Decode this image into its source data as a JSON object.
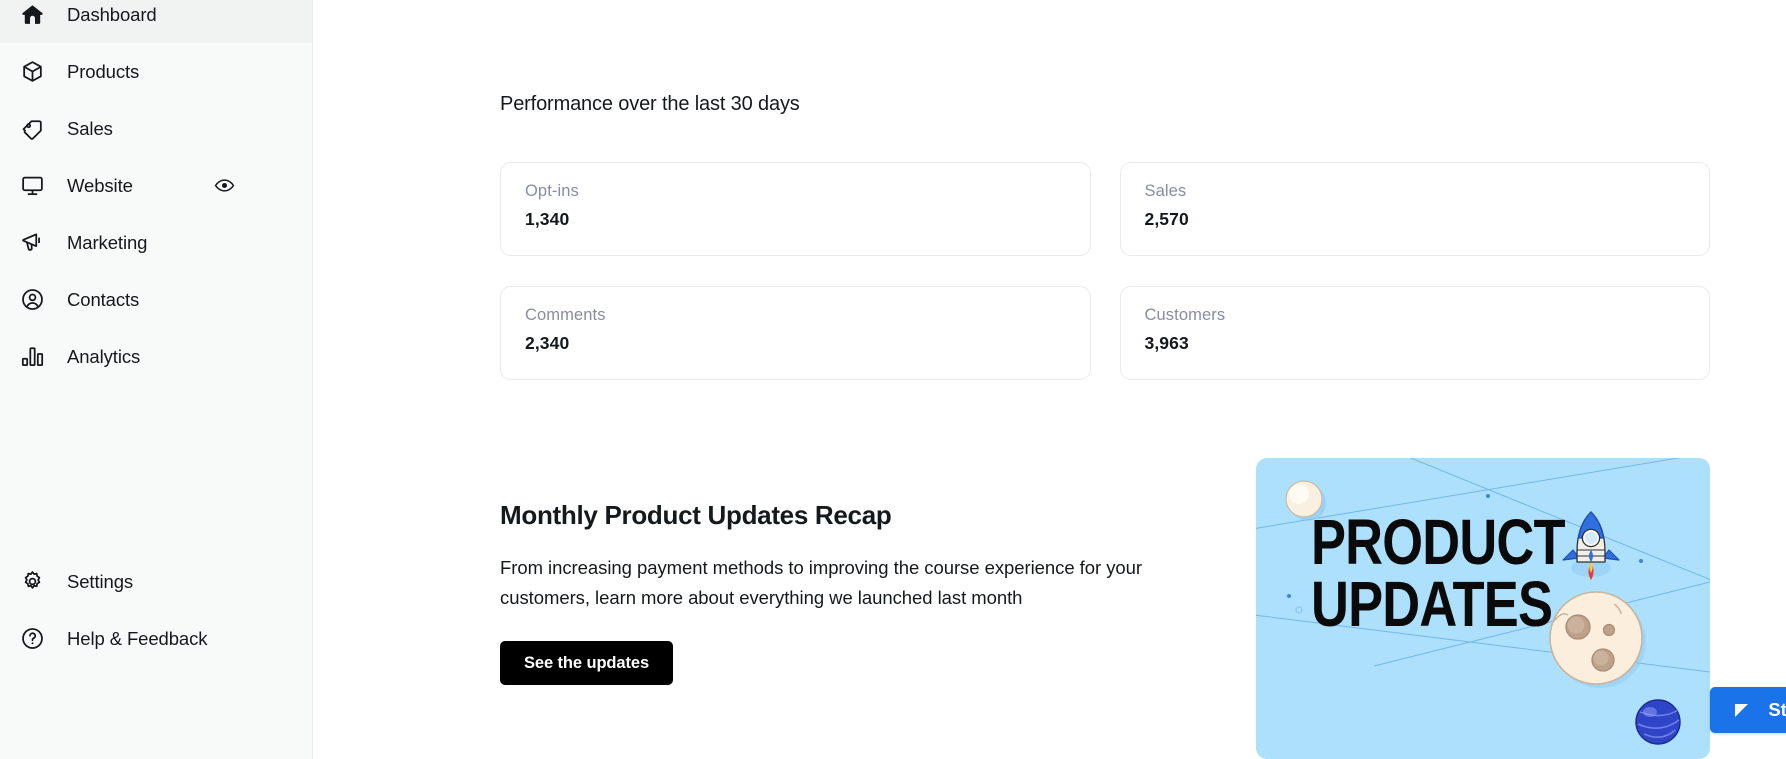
{
  "sidebar": {
    "top_items": [
      {
        "label": "Dashboard",
        "icon": "home-icon"
      },
      {
        "label": "Products",
        "icon": "box-icon"
      },
      {
        "label": "Sales",
        "icon": "tag-icon"
      },
      {
        "label": "Website",
        "icon": "monitor-icon",
        "trailing_icon": "eye-icon"
      },
      {
        "label": "Marketing",
        "icon": "megaphone-icon"
      },
      {
        "label": "Contacts",
        "icon": "user-circle-icon"
      },
      {
        "label": "Analytics",
        "icon": "bar-chart-icon"
      }
    ],
    "bottom_items": [
      {
        "label": "Settings",
        "icon": "gear-icon"
      },
      {
        "label": "Help & Feedback",
        "icon": "question-circle-icon"
      }
    ]
  },
  "main": {
    "performance_title": "Performance over the last 30 days",
    "stats": [
      {
        "label": "Opt-ins",
        "value": "1,340"
      },
      {
        "label": "Sales",
        "value": "2,570"
      },
      {
        "label": "Comments",
        "value": "2,340"
      },
      {
        "label": "Customers",
        "value": "3,963"
      }
    ],
    "promo": {
      "heading": "Monthly Product Updates Recap",
      "body": "From increasing payment methods to improving the course experience for your customers, learn more about everything we launched last month",
      "cta_label": "See the updates",
      "banner_title": "PRODUCT\nUPDATES",
      "banner_bg": "#ace0fd"
    }
  },
  "overlay": {
    "start_button_label": "Start",
    "start_button_color": "#1a73e8",
    "start_button_icon": "play-triangle-icon"
  }
}
